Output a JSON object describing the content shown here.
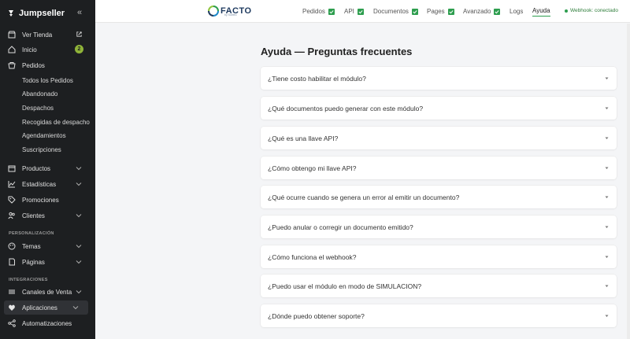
{
  "sidebar": {
    "brand": "Jumpseller",
    "items": [
      {
        "label": "Ver Tienda"
      },
      {
        "label": "Inicio",
        "badge": "2"
      },
      {
        "label": "Pedidos"
      }
    ],
    "pedidos_sub": [
      "Todos los Pedidos",
      "Abandonado",
      "Despachos",
      "Recogidas de despacho",
      "Agendamientos",
      "Suscripciones"
    ],
    "items2": [
      {
        "label": "Productos"
      },
      {
        "label": "Estadísticas"
      },
      {
        "label": "Promociones"
      },
      {
        "label": "Clientes"
      }
    ],
    "section_personalizacion": "PERSONALIZACIÓN",
    "items3": [
      {
        "label": "Temas"
      },
      {
        "label": "Páginas"
      }
    ],
    "section_integraciones": "INTEGRACIONES",
    "items4": [
      {
        "label": "Canales de Venta"
      },
      {
        "label": "Aplicaciones"
      },
      {
        "label": "Automatizaciones"
      }
    ]
  },
  "topbar": {
    "logo_text": "FACTO",
    "logo_sub": "by Subtec",
    "tabs": [
      {
        "label": "Pedidos",
        "checked": true
      },
      {
        "label": "API",
        "checked": true
      },
      {
        "label": "Documentos",
        "checked": true
      },
      {
        "label": "Pages",
        "checked": true
      },
      {
        "label": "Avanzado",
        "checked": true
      },
      {
        "label": "Logs",
        "checked": false
      },
      {
        "label": "Ayuda",
        "checked": false,
        "active": true
      }
    ],
    "webhook_status": "Webhook: conectado"
  },
  "main": {
    "title": "Ayuda — Preguntas frecuentes",
    "faqs": [
      "¿Tiene costo habilitar el módulo?",
      "¿Qué documentos puedo generar con este módulo?",
      "¿Qué es una llave API?",
      "¿Cómo obtengo mi llave API?",
      "¿Qué ocurre cuando se genera un error al emitir un documento?",
      "¿Puedo anular o corregir un documento emitido?",
      "¿Cómo funciona el webhook?",
      "¿Puedo usar el módulo en modo de SIMULACION?",
      "¿Dónde puedo obtener soporte?"
    ]
  },
  "colors": {
    "sidebar_bg": "#1d1f21",
    "accent_green": "#2e9e4f",
    "badge": "#8fb339"
  }
}
